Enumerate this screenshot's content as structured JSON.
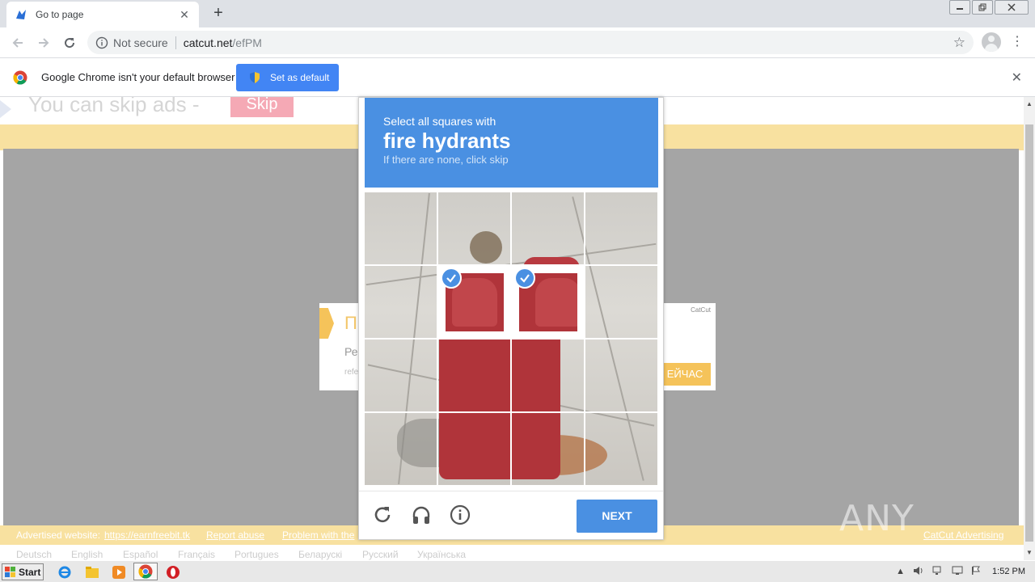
{
  "browser": {
    "tab_title": "Go to page",
    "tab_close": "✕",
    "new_tab": "+",
    "security_label": "Not secure",
    "url_host": "catcut.net",
    "url_path": "/efPM",
    "infobar_text": "Google Chrome isn't your default browser",
    "set_default_label": "Set as default",
    "infobar_close": "✕"
  },
  "page": {
    "skip_text": "You can skip ads  -",
    "skip_button": "Skip",
    "ad": {
      "title": "П",
      "subtitle": "Ре",
      "ref": "refe",
      "brand": "CatCut",
      "cta": "ЕЙЧАС"
    },
    "footer": {
      "advertised_label": "Advertised website:",
      "advertised_link": "https://earnfreebit.tk",
      "report_abuse": "Report abuse",
      "problem": "Problem with the",
      "catcut_ad": "CatCut Advertising"
    },
    "languages": [
      "Deutsch",
      "English",
      "Español",
      "Français",
      "Portugues",
      "Беларускі",
      "Русский",
      "Українська"
    ],
    "watermark": "ANY RUN"
  },
  "captcha": {
    "prompt": "Select all squares with",
    "target": "fire hydrants",
    "hint": "If there are none, click skip",
    "selected_tiles": [
      5,
      6
    ],
    "next_label": "NEXT",
    "footer_icons": [
      "reload-icon",
      "audio-icon",
      "info-icon"
    ]
  },
  "taskbar": {
    "start_label": "Start",
    "clock": "1:52 PM"
  },
  "colors": {
    "captcha_blue": "#4a90e2",
    "chrome_blue": "#4285f4",
    "band_yellow": "#f8e1a0",
    "skip_pink": "#f5a9b5"
  }
}
